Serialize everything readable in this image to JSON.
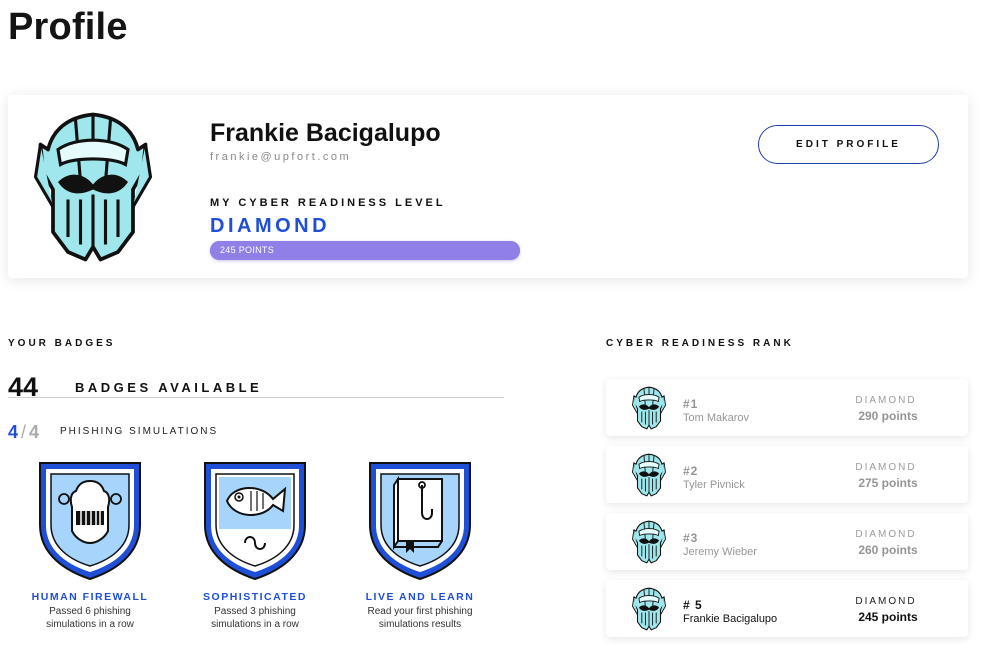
{
  "page": {
    "title": "Profile"
  },
  "profile": {
    "name": "Frankie Bacigalupo",
    "email": "frankie@upfort.com",
    "readiness_label": "MY CYBER READINESS LEVEL",
    "readiness_level": "DIAMOND",
    "points_text": "245 POINTS",
    "edit_button": "EDIT PROFILE",
    "avatar_icon": "knight-helmet-icon",
    "accent_color": "#1f4fd6",
    "bar_color": "#8f7fe6"
  },
  "badges": {
    "section_label": "YOUR BADGES",
    "count": "44",
    "available_label": "BADGES AVAILABLE",
    "phishing": {
      "current": "4",
      "separator": "/",
      "total": "4",
      "label": "PHISHING SIMULATIONS"
    },
    "items": [
      {
        "name": "HUMAN FIREWALL",
        "desc_line1": "Passed 6 phishing",
        "desc_line2": "simulations in a row",
        "icon": "knight-shield-icon"
      },
      {
        "name": "SOPHISTICATED",
        "desc_line1": "Passed 3 phishing",
        "desc_line2": "simulations in a row",
        "icon": "fish-shield-icon"
      },
      {
        "name": "LIVE AND LEARN",
        "desc_line1": "Read your first phishing",
        "desc_line2": "simulations results",
        "icon": "book-hook-shield-icon"
      }
    ]
  },
  "rank": {
    "section_label": "CYBER READINESS RANK",
    "items": [
      {
        "rank": "#1",
        "name": "Tom Makarov",
        "tier": "DIAMOND",
        "points": "290 points"
      },
      {
        "rank": "#2",
        "name": "Tyler Pivnick",
        "tier": "DIAMOND",
        "points": "275 points"
      },
      {
        "rank": "#3",
        "name": "Jeremy Wieber",
        "tier": "DIAMOND",
        "points": "260 points"
      },
      {
        "rank": "# 5",
        "name": "Frankie Bacigalupo",
        "tier": "DIAMOND",
        "points": "245 points"
      }
    ]
  }
}
